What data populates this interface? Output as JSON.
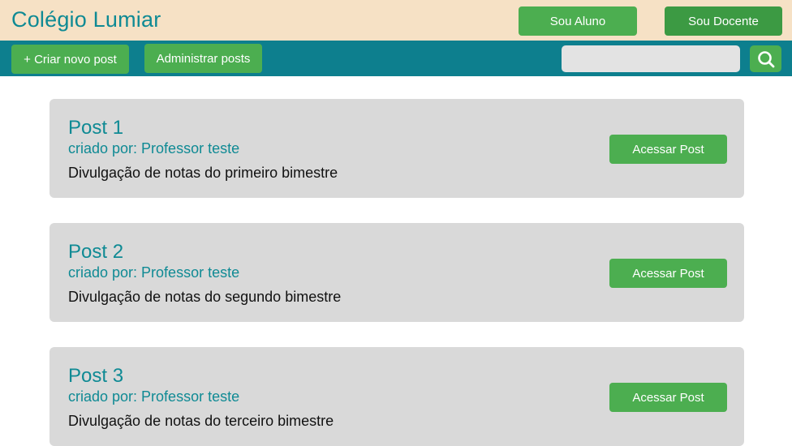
{
  "header": {
    "brand": "Colégio Lumiar",
    "role_buttons": [
      "Sou Aluno",
      "Sou Docente"
    ]
  },
  "toolbar": {
    "create_label": "+ Criar novo post",
    "admin_label": "Administrar posts",
    "search_value": "",
    "search_icon": "search-icon"
  },
  "posts": [
    {
      "title": "Post 1",
      "author": "criado por: Professor teste",
      "description": "Divulgação de notas do primeiro bimestre",
      "button_label": "Acessar Post"
    },
    {
      "title": "Post 2",
      "author": "criado por: Professor teste",
      "description": "Divulgação de notas do segundo bimestre",
      "button_label": "Acessar Post"
    },
    {
      "title": "Post 3",
      "author": "criado por: Professor teste",
      "description": "Divulgação de notas do terceiro bimestre",
      "button_label": "Acessar Post"
    }
  ],
  "colors": {
    "topbar": "#f6e1c5",
    "navbar": "#0d7f8e",
    "accent_green": "#4cae50",
    "accent_text": "#0f8a94",
    "card_bg": "#d9d9d9"
  }
}
